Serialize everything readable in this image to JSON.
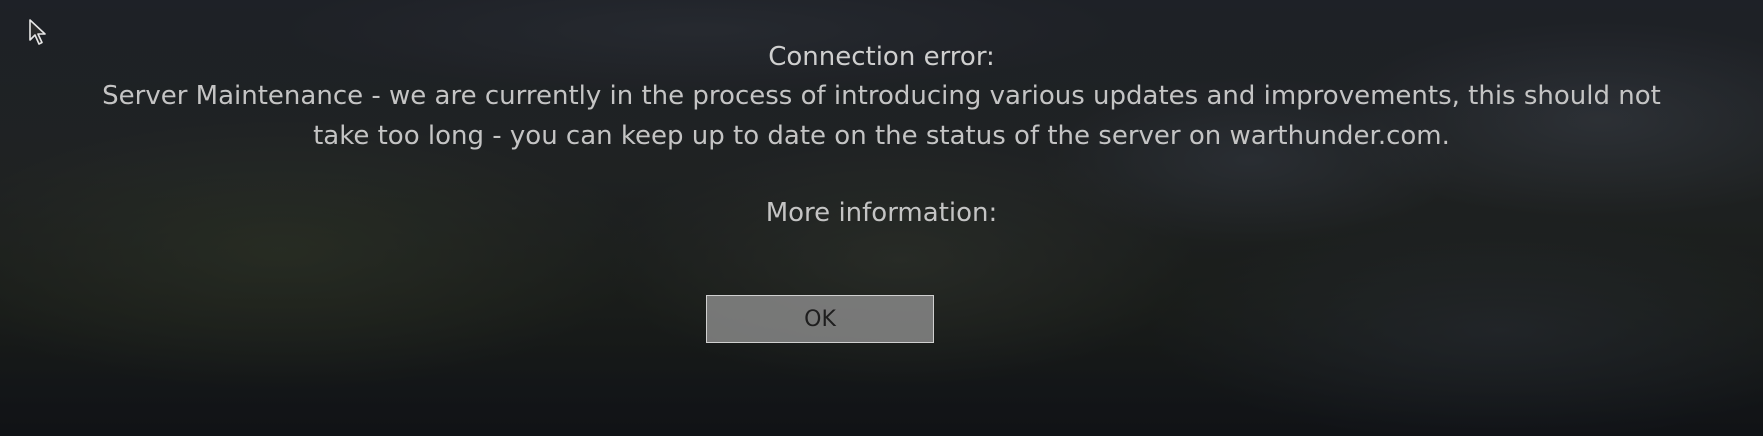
{
  "dialog": {
    "title": "Connection error:",
    "message": "Server Maintenance - we are currently in the process of introducing various updates and improvements, this should not take too long - you can keep up to date on the status of the server on warthunder.com.",
    "more_info": "More information:",
    "ok_label": "OK"
  },
  "cursor": {
    "icon": "mouse-pointer-icon"
  }
}
